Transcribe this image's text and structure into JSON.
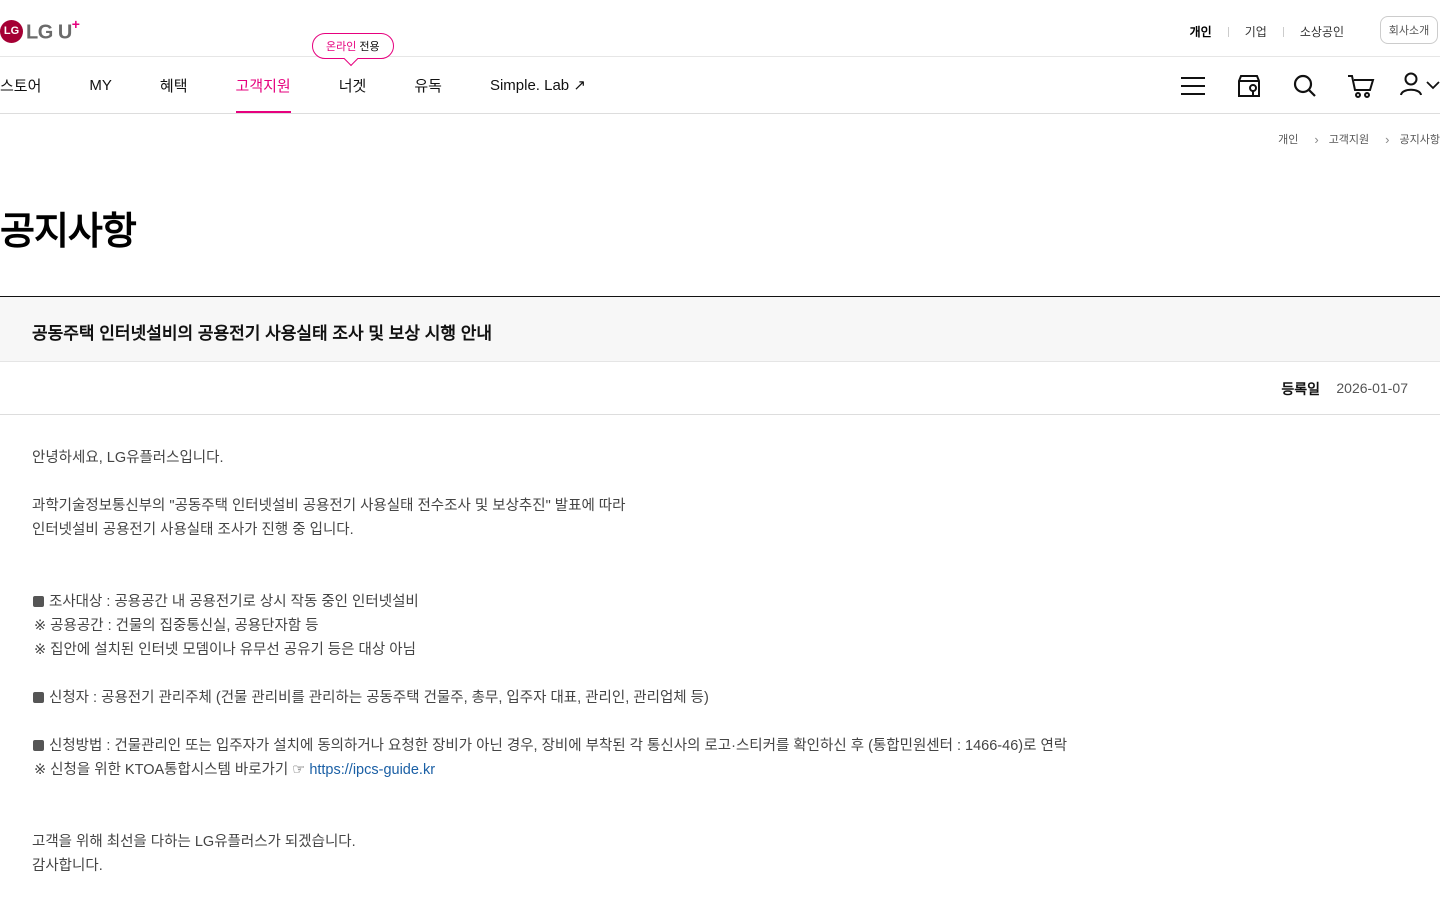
{
  "header": {
    "logo_mark": "LG",
    "logo_text": "LG U",
    "logo_plus": "+",
    "segments": [
      "개인",
      "기업",
      "소상공인"
    ],
    "company_button": "회사소개"
  },
  "gnb": {
    "items": [
      "스토어",
      "MY",
      "혜택",
      "고객지원",
      "너겟",
      "유독",
      "Simple. Lab ↗"
    ],
    "active_index": 3,
    "badge_pink": "온라인",
    "badge_text": "전용",
    "icons": [
      "menu-icon",
      "store-location-icon",
      "search-icon",
      "cart-icon",
      "user-icon"
    ]
  },
  "breadcrumb": [
    "개인",
    "고객지원",
    "공지사항"
  ],
  "page_title": "공지사항",
  "notice": {
    "title": "공동주택 인터넷설비의 공용전기 사용실태 조사 및 보상 시행 안내",
    "date_label": "등록일",
    "date": "2026-01-07",
    "body": {
      "greeting": "안녕하세요, LG유플러스입니다.",
      "intro1": "과학기술정보통신부의 \"공동주택 인터넷설비 공용전기 사용실태 전수조사 및 보상추진\" 발표에 따라",
      "intro2": "인터넷설비 공용전기 사용실태 조사가 진행 중 입니다.",
      "target": "조사대상 : 공용공간 내 공용전기로 상시 작동 중인 인터넷설비",
      "target_note1": "※ 공용공간 : 건물의 집중통신실, 공용단자함 등",
      "target_note2": "※ 집안에 설치된 인터넷 모뎀이나 유무선 공유기 등은 대상 아님",
      "applicant": "신청자 : 공용전기 관리주체 (건물 관리비를 관리하는 공동주택 건물주, 총무, 입주자 대표, 관리인, 관리업체 등)",
      "method": "신청방법 : 건물관리인 또는 입주자가 설치에 동의하거나 요청한 장비가 아닌 경우, 장비에 부착된 각 통신사의 로고·스티커를 확인하신 후 (통합민원센터 : 1466-46)로 연락",
      "method_note": "※ 신청을 위한 KTOA통합시스템 바로가기 ☞",
      "method_link": "https://ipcs-guide.kr",
      "closing1": "고객을 위해 최선을 다하는 LG유플러스가 되겠습니다.",
      "closing2": "감사합니다."
    }
  },
  "colors": {
    "brand_pink": "#e6007e",
    "logo_red": "#a50034",
    "link_blue": "#1a5fa5"
  }
}
